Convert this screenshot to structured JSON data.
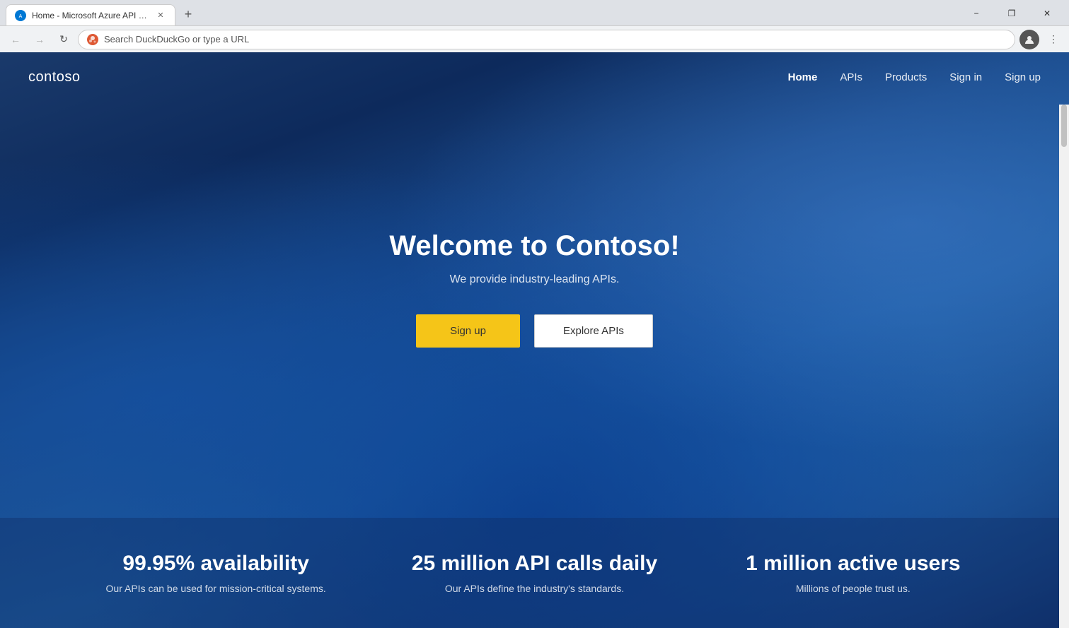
{
  "browser": {
    "tab_title": "Home - Microsoft Azure API Mar...",
    "new_tab_tooltip": "+",
    "address_placeholder": "Search DuckDuckGo or type a URL",
    "window_minimize": "−",
    "window_restore": "❐",
    "window_close": "✕"
  },
  "nav": {
    "back_icon": "←",
    "forward_icon": "→",
    "refresh_icon": "↻",
    "menu_icon": "⋮"
  },
  "site": {
    "logo": "contoso",
    "nav_links": [
      {
        "label": "Home",
        "active": true
      },
      {
        "label": "APIs",
        "active": false
      },
      {
        "label": "Products",
        "active": false
      },
      {
        "label": "Sign in",
        "active": false
      },
      {
        "label": "Sign up",
        "active": false
      }
    ],
    "hero": {
      "title": "Welcome to Contoso!",
      "subtitle": "We provide industry-leading APIs.",
      "signup_btn": "Sign up",
      "explore_btn": "Explore APIs"
    },
    "stats": [
      {
        "value": "99.95% availability",
        "description": "Our APIs can be used for mission-critical systems."
      },
      {
        "value": "25 million API calls daily",
        "description": "Our APIs define the industry's standards."
      },
      {
        "value": "1 million active users",
        "description": "Millions of people trust us."
      }
    ]
  }
}
